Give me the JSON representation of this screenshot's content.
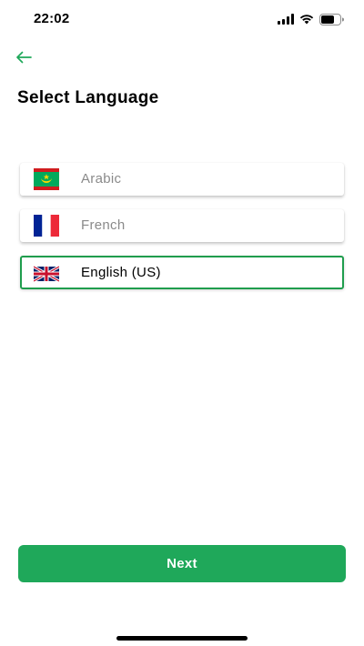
{
  "status_bar": {
    "time": "22:02"
  },
  "header": {
    "back_icon": "arrow-left-icon",
    "title": "Select Language"
  },
  "languages": [
    {
      "label": "Arabic",
      "flag": "mauritania-flag-icon",
      "selected": false
    },
    {
      "label": "French",
      "flag": "france-flag-icon",
      "selected": false
    },
    {
      "label": "English (US)",
      "flag": "uk-flag-icon",
      "selected": true
    }
  ],
  "actions": {
    "next_label": "Next"
  },
  "colors": {
    "accent": "#1fa85a",
    "selected_border": "#1f9d4d",
    "unselected_text": "#8a8a8a"
  }
}
